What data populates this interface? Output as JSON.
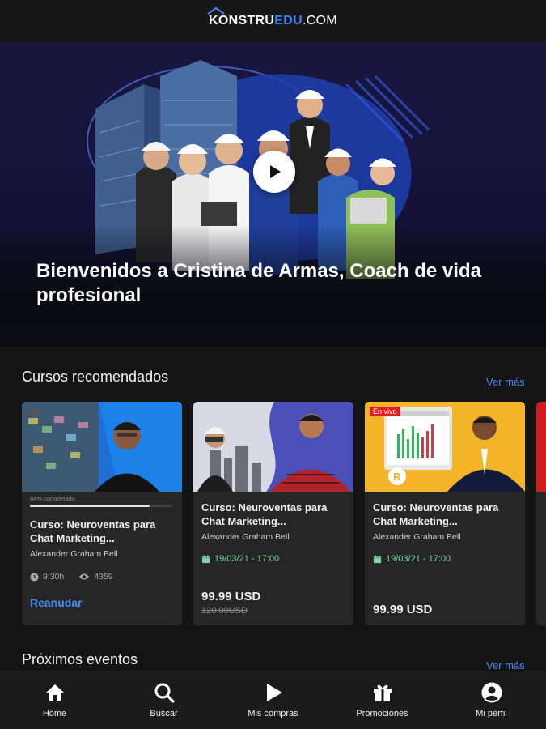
{
  "header": {
    "logo_part1": "KONSTRU",
    "logo_part2": "EDU",
    "logo_part3": ".COM"
  },
  "hero": {
    "title": "Bienvenidos a Cristina de Armas, Coach de vida profesional",
    "play_icon": "play-icon"
  },
  "recommended": {
    "title": "Cursos recomendados",
    "see_more": "Ver más",
    "cards": [
      {
        "progress_label": "84% completado",
        "progress": 0.84,
        "title": "Curso: Neuroventas para Chat Marketing...",
        "author": "Alexander Graham Bell",
        "duration": "9:30h",
        "views": "4359",
        "action": "Reanudar"
      },
      {
        "title": "Curso: Neuroventas para Chat Marketing...",
        "author": "Alexander Graham Bell",
        "date": "19/03/21 - 17:00",
        "price": "99.99 USD",
        "old_price": "120.00USD"
      },
      {
        "badge": "En vivo",
        "title": "Curso: Neuroventas para Chat Marketing...",
        "author": "Alexander Graham Bell",
        "date": "19/03/21 - 17:00",
        "price": "99.99 USD"
      }
    ]
  },
  "events": {
    "title": "Próximos eventos",
    "see_more": "Ver más"
  },
  "nav": {
    "items": [
      {
        "label": "Home",
        "icon": "home-icon"
      },
      {
        "label": "Buscar",
        "icon": "search-icon"
      },
      {
        "label": "Mis compras",
        "icon": "play-icon"
      },
      {
        "label": "Promociones",
        "icon": "gift-icon"
      },
      {
        "label": "Mi perfil",
        "icon": "user-circle-icon"
      }
    ]
  },
  "colors": {
    "background": "#141414",
    "accent": "#4a8cf0",
    "date_green": "#7ed3a0",
    "card": "#262626"
  }
}
